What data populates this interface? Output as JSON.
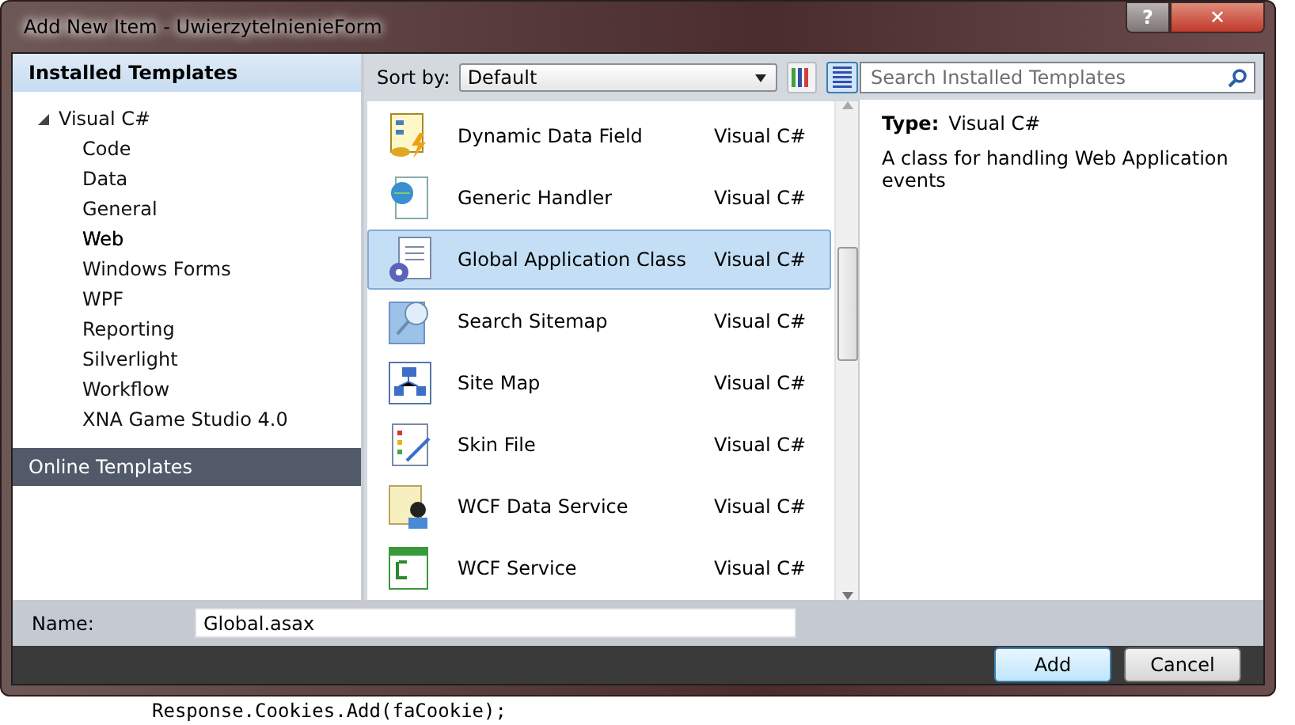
{
  "window": {
    "title": "Add New Item - UwierzytelnienieForm",
    "buttons": [
      "?",
      "✕"
    ]
  },
  "sidebar": {
    "installed_header": "Installed Templates",
    "tree": [
      {
        "label": "Visual C#",
        "expanded": true,
        "selected": false,
        "children": [
          {
            "label": "Code",
            "selected": false
          },
          {
            "label": "Data",
            "selected": false
          },
          {
            "label": "General",
            "selected": false
          },
          {
            "label": "Web",
            "selected": true
          },
          {
            "label": "Windows Forms",
            "selected": false
          },
          {
            "label": "WPF",
            "selected": false
          },
          {
            "label": "Reporting",
            "selected": false
          },
          {
            "label": "Silverlight",
            "selected": false
          },
          {
            "label": "Workflow",
            "selected": false
          },
          {
            "label": "XNA Game Studio 4.0",
            "selected": false
          }
        ]
      }
    ],
    "online_header": "Online Templates"
  },
  "toolbar": {
    "sort_label": "Sort by:",
    "sort_value": "Default",
    "views": [
      {
        "kind": "medium",
        "selected": false
      },
      {
        "kind": "list",
        "selected": true
      }
    ]
  },
  "search": {
    "placeholder": "Search Installed Templates"
  },
  "templates": [
    {
      "name": "Dynamic Data Field",
      "language": "Visual C#",
      "kind": "data",
      "selected": false
    },
    {
      "name": "Generic Handler",
      "language": "Visual C#",
      "kind": "handler",
      "selected": false
    },
    {
      "name": "Global Application Class",
      "language": "Visual C#",
      "kind": "gear",
      "selected": true
    },
    {
      "name": "Search Sitemap",
      "language": "Visual C#",
      "kind": "search",
      "selected": false
    },
    {
      "name": "Site Map",
      "language": "Visual C#",
      "kind": "sitemap",
      "selected": false
    },
    {
      "name": "Skin File",
      "language": "Visual C#",
      "kind": "skin",
      "selected": false
    },
    {
      "name": "WCF Data Service",
      "language": "Visual C#",
      "kind": "person",
      "selected": false
    },
    {
      "name": "WCF Service",
      "language": "Visual C#",
      "kind": "csharp",
      "selected": false
    }
  ],
  "details": {
    "type_label": "Type:",
    "type_value": "Visual C#",
    "description": "A class for handling Web Application events"
  },
  "name_field": {
    "label": "Name:",
    "value": "Global.asax"
  },
  "buttons": [
    {
      "label": "Add",
      "default": true
    },
    {
      "label": "Cancel",
      "default": false
    }
  ],
  "background_code": "Response.Cookies.Add(faCookie);"
}
